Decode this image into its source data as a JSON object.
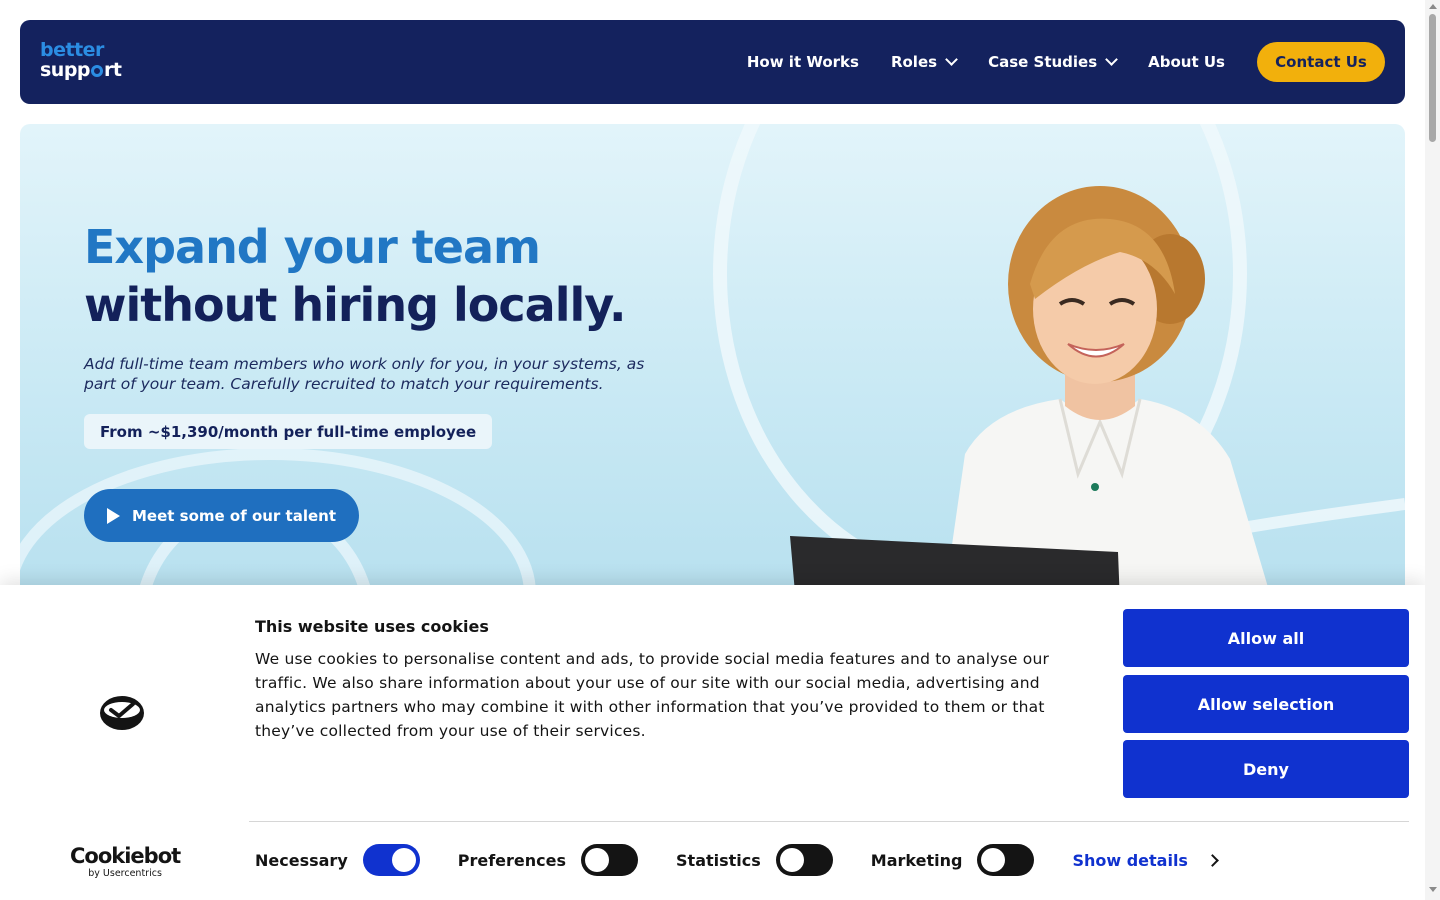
{
  "brand": {
    "line1": "better",
    "line2a": "supp",
    "line2b": "rt"
  },
  "nav": {
    "items": [
      {
        "label": "How it Works"
      },
      {
        "label": "Roles"
      },
      {
        "label": "Case Studies"
      },
      {
        "label": "About Us"
      }
    ],
    "contact_label": "Contact Us"
  },
  "hero": {
    "headline_1": "Expand your team",
    "headline_2": "without hiring locally.",
    "subtitle": "Add full-time team members who work only for you, in your systems, as part of your team. Carefully recruited to match your requirements.",
    "price": "From ~$1,390/month per full-time employee",
    "cta_label": "Meet some of our talent"
  },
  "cookie_banner": {
    "title": "This website uses cookies",
    "text": "We use cookies to personalise content and ads, to provide social media features and to analyse our traffic. We also share information about your use of our site with our social media, advertising and analytics partners who may combine it with other information that you’ve provided to them or that they’ve collected from your use of their services.",
    "allow_all": "Allow all",
    "allow_selection": "Allow selection",
    "deny": "Deny",
    "toggles": [
      {
        "label": "Necessary",
        "on": true
      },
      {
        "label": "Preferences",
        "on": false
      },
      {
        "label": "Statistics",
        "on": false
      },
      {
        "label": "Marketing",
        "on": false
      }
    ],
    "show_details": "Show details",
    "brand_name": "Cookiebot",
    "brand_sub": "by Usercentrics"
  },
  "colors": {
    "navy": "#14225e",
    "accent_yellow": "#f2b00c",
    "hero_blue": "#2177c4",
    "cookie_blue": "#1032cf"
  }
}
